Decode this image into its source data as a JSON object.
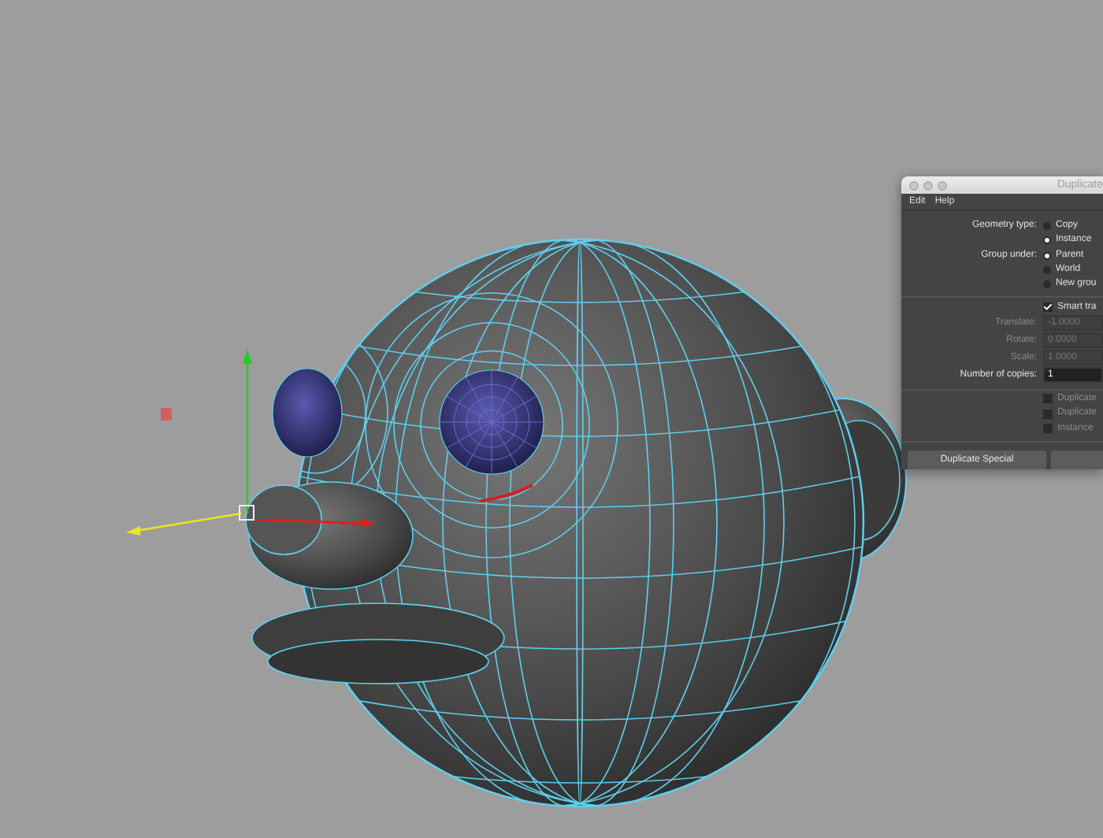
{
  "dialog": {
    "title": "Duplicate",
    "menu": [
      "Edit",
      "Help"
    ],
    "radio_groups": [
      {
        "label": "Geometry type:",
        "options": [
          {
            "label": "Copy",
            "selected": false
          },
          {
            "label": "Instance",
            "selected": true
          }
        ]
      },
      {
        "label": "Group under:",
        "options": [
          {
            "label": "Parent",
            "selected": true
          },
          {
            "label": "World",
            "selected": false
          },
          {
            "label": "New grou",
            "selected": false
          }
        ]
      }
    ],
    "smart_transform": {
      "label": "Smart tra",
      "checked": true
    },
    "fields": [
      {
        "label": "Translate:",
        "value": "-1.0000",
        "disabled": true
      },
      {
        "label": "Rotate:",
        "value": "0.0000",
        "disabled": true
      },
      {
        "label": "Scale:",
        "value": "1.0000",
        "disabled": true
      },
      {
        "label": "Number of copies:",
        "value": "1",
        "disabled": false
      }
    ],
    "options": [
      {
        "label": "Duplicate",
        "checked": false
      },
      {
        "label": "Duplicate",
        "checked": false
      },
      {
        "label": "Instance",
        "checked": false
      }
    ],
    "buttons": [
      "Duplicate Special"
    ]
  }
}
